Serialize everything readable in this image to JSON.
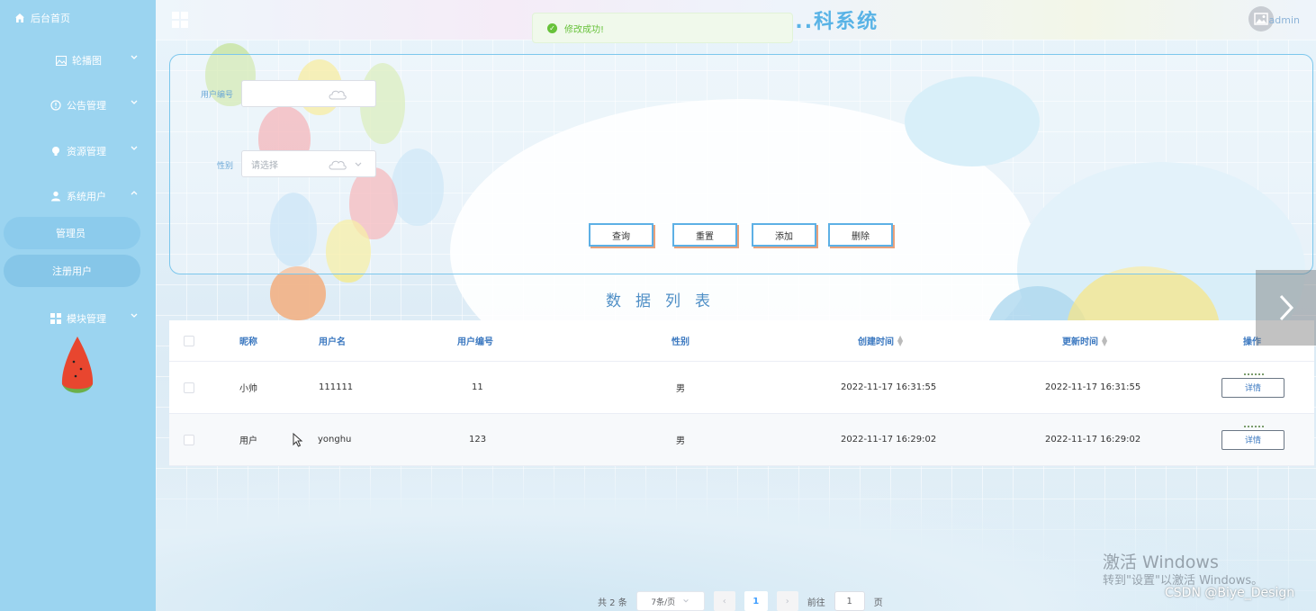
{
  "sidebar": {
    "home_label": "后台首页",
    "menus": [
      {
        "label": "轮播图",
        "icon": "image-icon"
      },
      {
        "label": "公告管理",
        "icon": "info-icon"
      },
      {
        "label": "资源管理",
        "icon": "bulb-icon"
      },
      {
        "label": "系统用户",
        "icon": "user-icon"
      },
      {
        "label": "模块管理",
        "icon": "grid-icon"
      }
    ],
    "submenu": [
      {
        "label": "管理员"
      },
      {
        "label": "注册用户"
      }
    ]
  },
  "header": {
    "title": "...科系统",
    "username": "admin"
  },
  "toast": {
    "message": "修改成功!"
  },
  "search": {
    "user_no_label": "用户编号",
    "user_no_value": "",
    "gender_label": "性别",
    "gender_placeholder": "请选择",
    "buttons": {
      "query": "查询",
      "reset": "重置",
      "add": "添加",
      "delete": "删除"
    }
  },
  "list_title": "数据列表",
  "table": {
    "headers": {
      "nickname": "昵称",
      "username": "用户名",
      "user_no": "用户编号",
      "gender": "性别",
      "created": "创建时间",
      "updated": "更新时间",
      "actions": "操作"
    },
    "rows": [
      {
        "nickname": "小帅",
        "username": "111111",
        "user_no": "11",
        "gender": "男",
        "created": "2022-11-17 16:31:55",
        "updated": "2022-11-17 16:31:55",
        "action": "详情"
      },
      {
        "nickname": "用户",
        "username": "yonghu",
        "user_no": "123",
        "gender": "男",
        "created": "2022-11-17 16:29:02",
        "updated": "2022-11-17 16:29:02",
        "action": "详情"
      }
    ]
  },
  "pagination": {
    "total_text": "共 2 条",
    "page_size": "7条/页",
    "current_page": "1",
    "goto_label": "前往",
    "goto_value": "1",
    "page_suffix": "页"
  },
  "overlay": {
    "windows_line1": "激活 Windows",
    "windows_line2": "转到\"设置\"以激活 Windows。",
    "csdn": "CSDN @Biye_Design"
  },
  "colors": {
    "sidebar_bg": "#9bd4f0",
    "accent": "#5db0e5",
    "success": "#67c23a"
  }
}
